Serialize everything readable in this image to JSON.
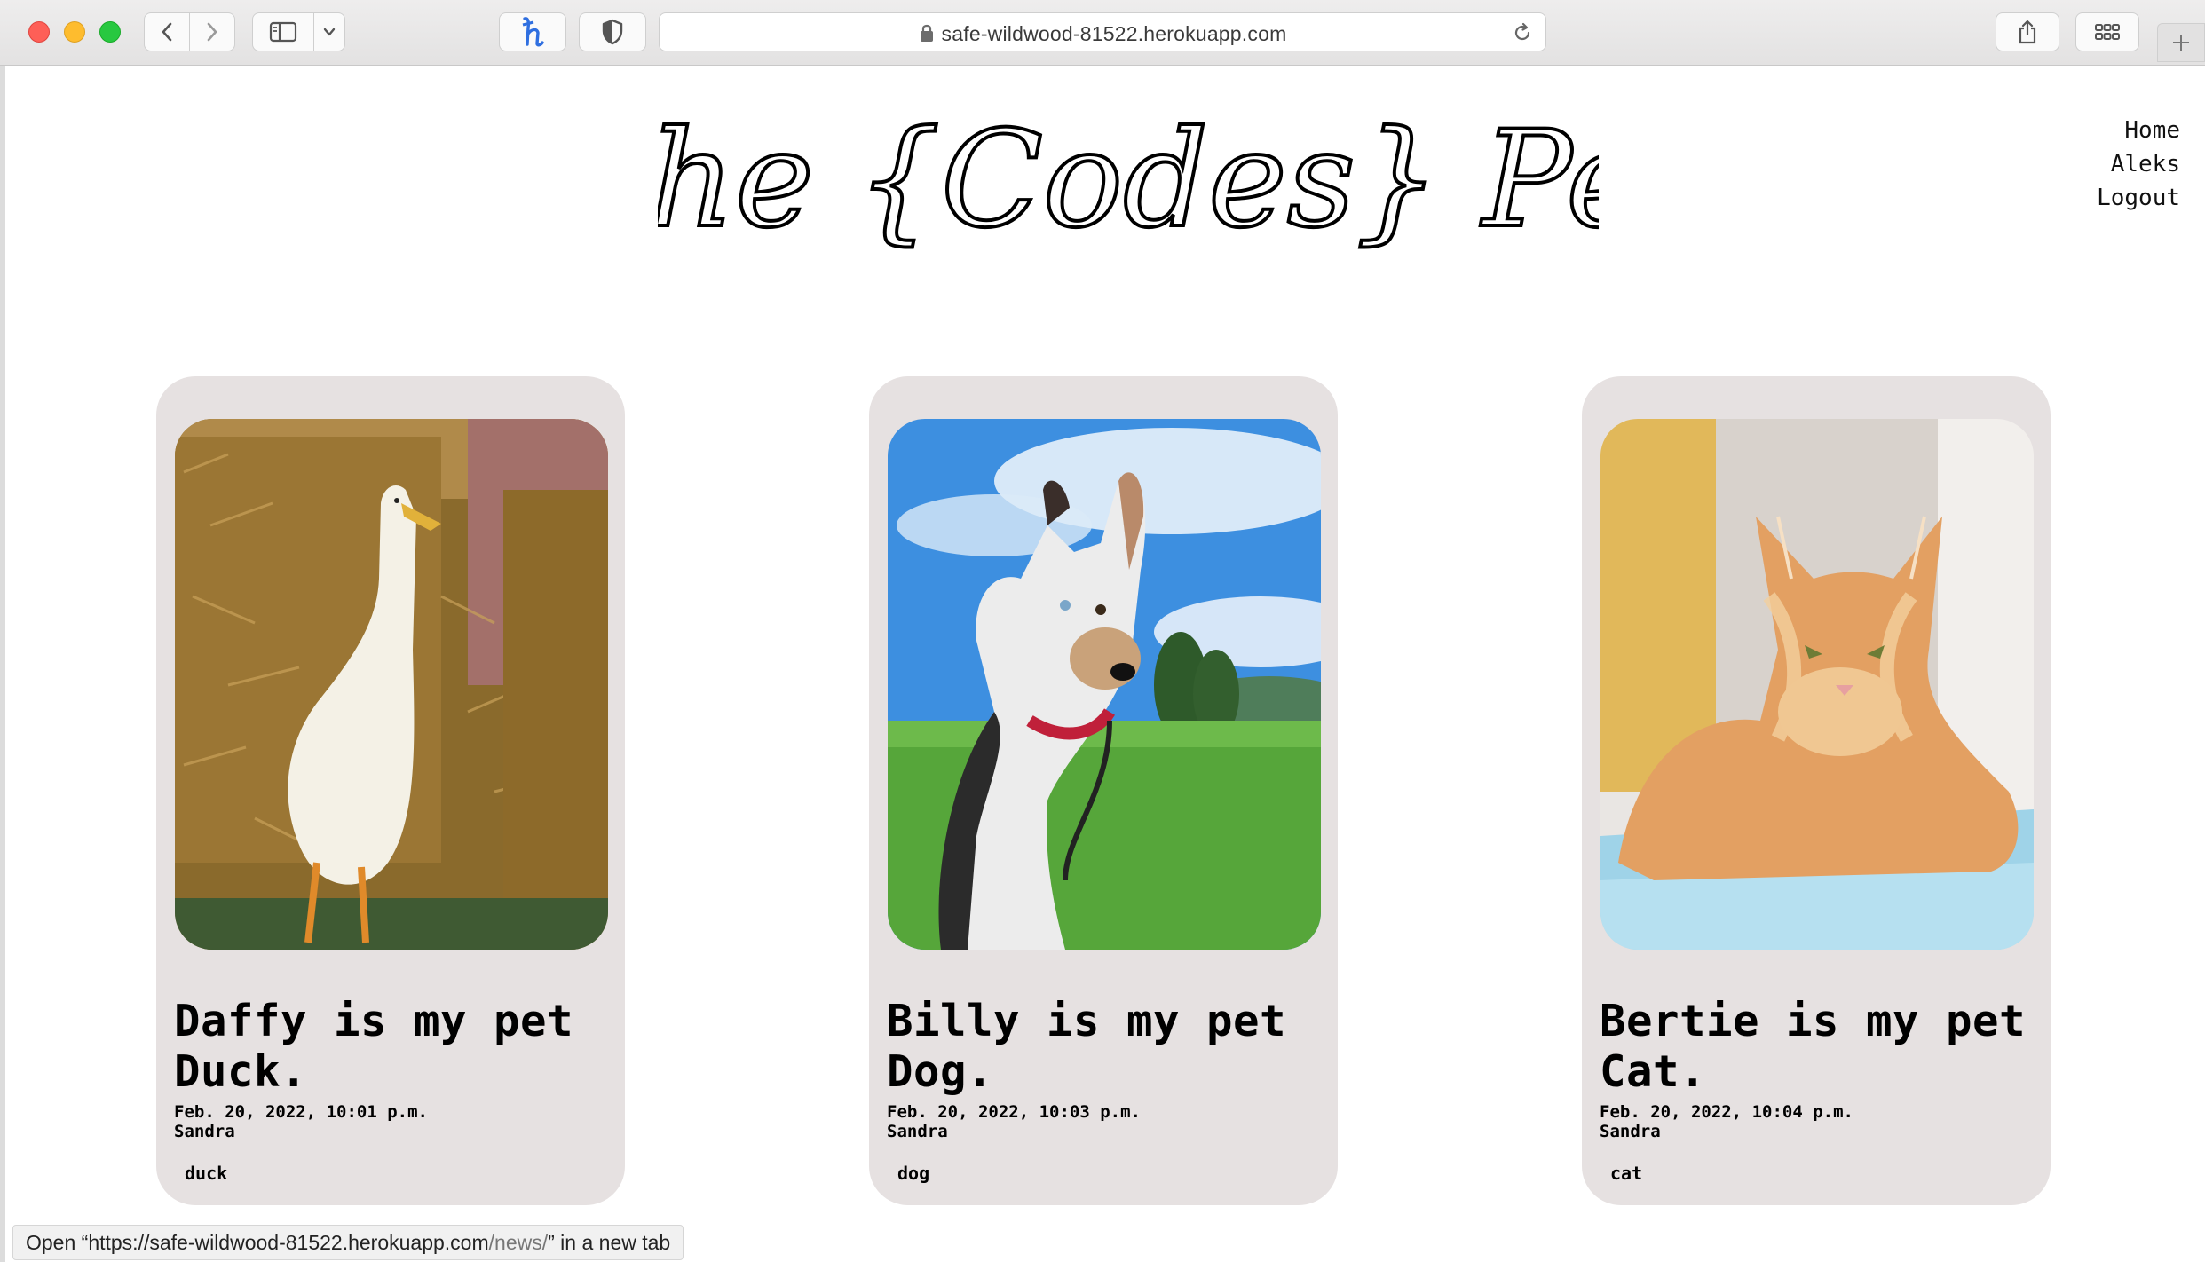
{
  "browser": {
    "url": "safe-wildwood-81522.herokuapp.com",
    "status_prefix": "Open “https://safe-wildwood-81522.herokuapp.com",
    "status_path": "/news/",
    "status_suffix": "” in a new tab",
    "icons": [
      "back-icon",
      "forward-icon",
      "sidebar-icon",
      "chevron-down-icon",
      "honey-extension-icon",
      "shield-icon",
      "lock-icon",
      "reload-icon",
      "share-icon",
      "tab-overview-icon",
      "plus-icon"
    ],
    "traffic_colors": {
      "close": "#fe5f57",
      "minimize": "#febc2e",
      "maximize": "#28c840"
    }
  },
  "site": {
    "logo": "She {Codes} Pet",
    "nav": [
      {
        "label": "Home"
      },
      {
        "label": "Aleks"
      },
      {
        "label": "Logout"
      }
    ]
  },
  "posts": [
    {
      "title": "Daffy is my pet Duck.",
      "date": "Feb. 20, 2022, 10:01 p.m.",
      "author": "Sandra",
      "tag": "duck",
      "image": "white duck standing by hay bales"
    },
    {
      "title": "Billy is my pet Dog.",
      "date": "Feb. 20, 2022, 10:03 p.m.",
      "author": "Sandra",
      "tag": "dog",
      "image": "merle puppy sitting on grass"
    },
    {
      "title": "Bertie is my pet Cat.",
      "date": "Feb. 20, 2022, 10:04 p.m.",
      "author": "Sandra",
      "tag": "cat",
      "image": "ginger maine coon lying on blanket"
    }
  ],
  "colors": {
    "card_bg": "#e6e1e1",
    "text": "#000000"
  }
}
